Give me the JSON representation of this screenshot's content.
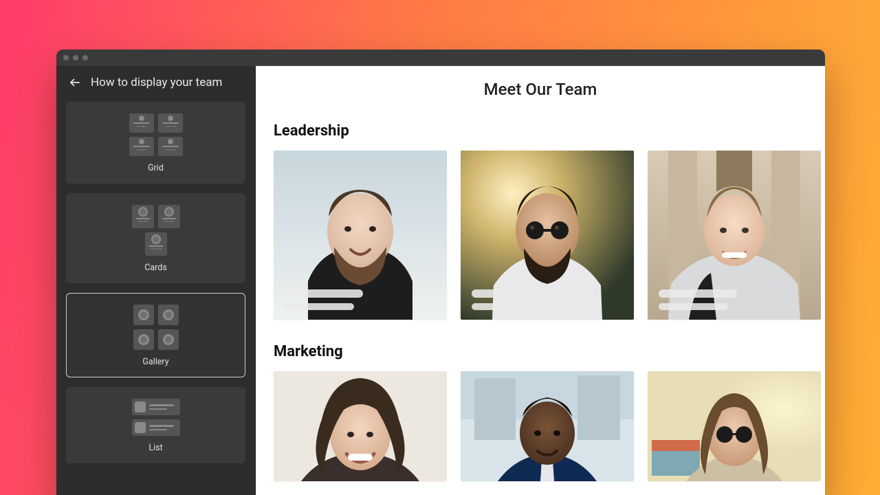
{
  "sidebar": {
    "title": "How to display your team",
    "options": [
      {
        "label": "Grid"
      },
      {
        "label": "Cards"
      },
      {
        "label": "Gallery"
      },
      {
        "label": "List"
      }
    ],
    "selected_index": 2
  },
  "main": {
    "page_title": "Meet Our Team",
    "sections": [
      {
        "title": "Leadership"
      },
      {
        "title": "Marketing"
      }
    ]
  }
}
